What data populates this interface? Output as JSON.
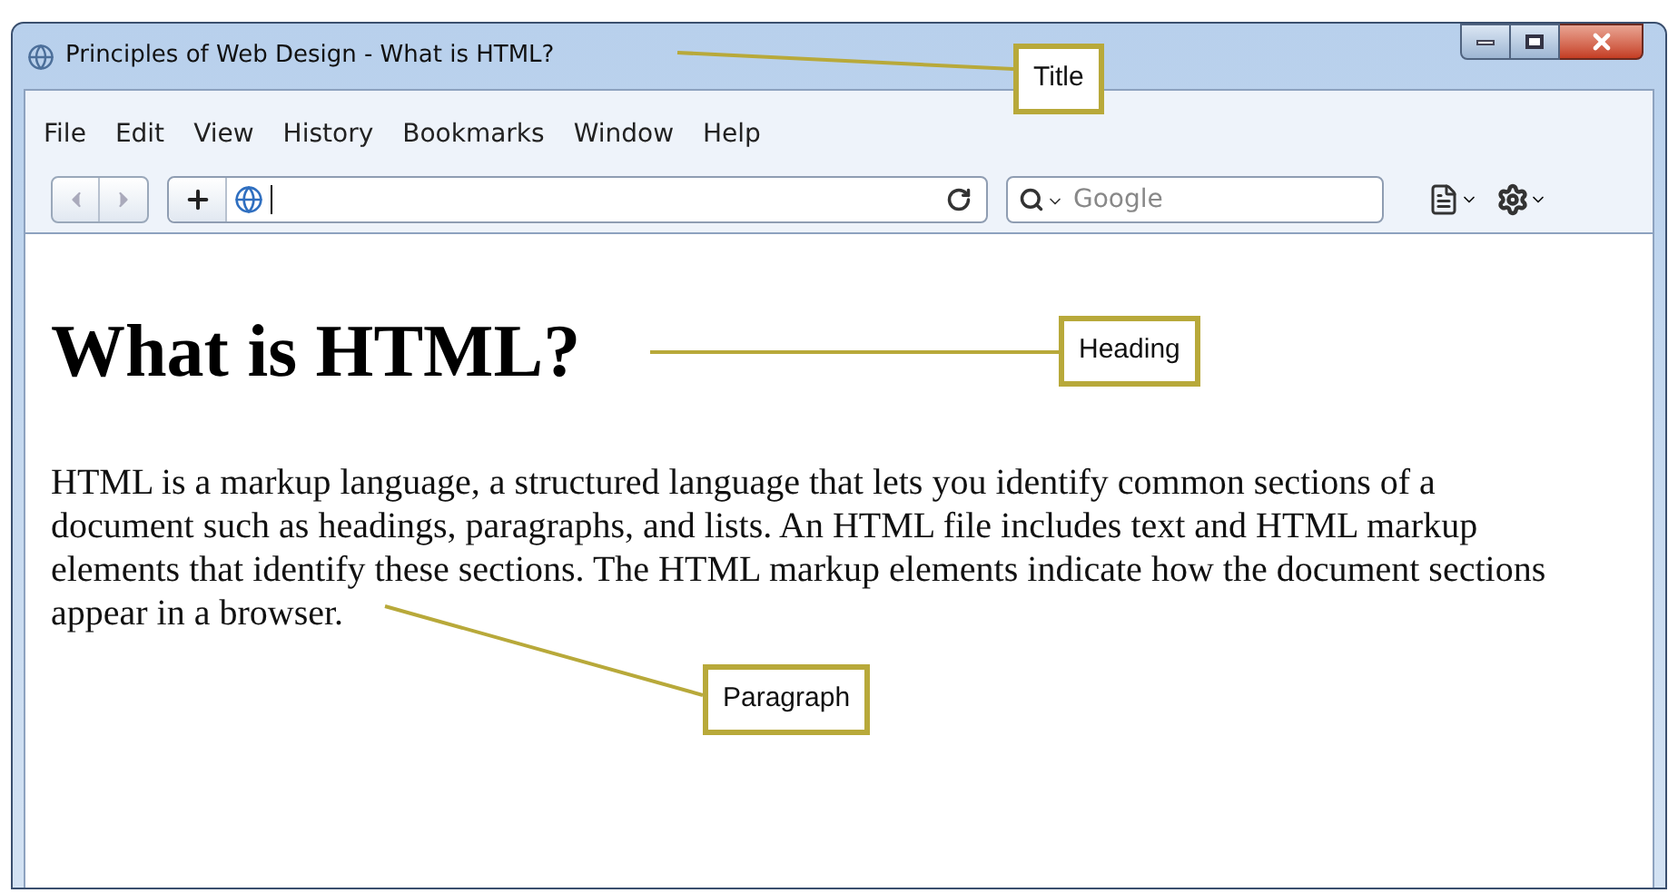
{
  "window": {
    "title": "Principles of Web Design - What is HTML?"
  },
  "menu": [
    "File",
    "Edit",
    "View",
    "History",
    "Bookmarks",
    "Window",
    "Help"
  ],
  "toolbar": {
    "search": {
      "placeholder": "Google"
    }
  },
  "page": {
    "heading": "What is HTML?",
    "paragraph": "HTML is a markup language, a structured language that lets you identify common sections of a document such as headings, paragraphs, and lists. An HTML file includes text and HTML markup elements that identify these sections. The HTML markup elements indicate how the document sections appear in a browser."
  },
  "callouts": [
    {
      "label": "Title"
    },
    {
      "label": "Heading"
    },
    {
      "label": "Paragraph"
    }
  ]
}
